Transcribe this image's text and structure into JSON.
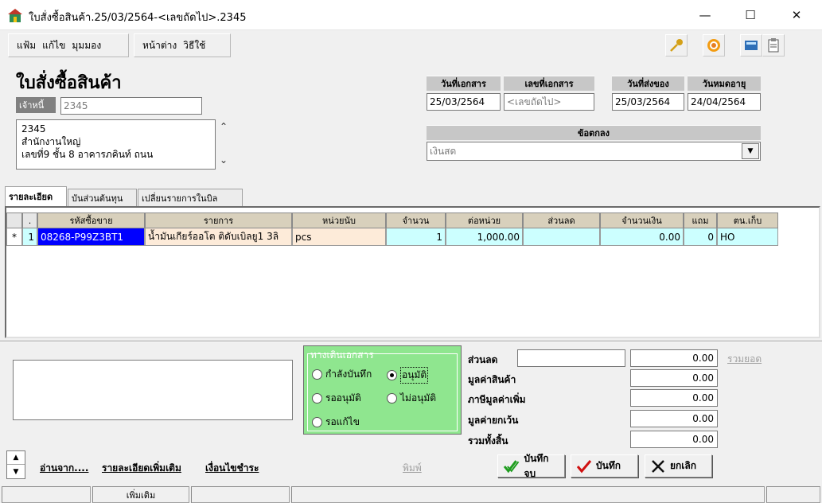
{
  "window": {
    "title": "ใบสั่งซื้อสินค้า.25/03/2564-<เลขถัดไป>.2345",
    "min": "—",
    "max": "☐",
    "close": "✕"
  },
  "menu": {
    "file": "แฟ้ม",
    "edit": "แก้ไข",
    "view": "มุมมอง",
    "window": "หน้าต่าง",
    "help": "วิธีใช้"
  },
  "header": {
    "doc_title": "ใบสั่งซื้อสินค้า",
    "creditor_label": "เจ้าหนี้",
    "creditor_value": "2345",
    "address_lines": [
      "2345",
      "สำนักงานใหญ่",
      "เลขที่9 ชั้น 8 อาคารภคินท์ ถนน"
    ],
    "doc_date_label": "วันที่เอกสาร",
    "doc_date_value": "25/03/2564",
    "doc_no_label": "เลขที่เอกสาร",
    "doc_no_value": "<เลขถัดไป>",
    "ship_date_label": "วันที่ส่งของ",
    "ship_date_value": "25/03/2564",
    "expire_label": "วันหมดอายุ",
    "expire_value": "24/04/2564",
    "terms_label": "ข้อตกลง",
    "terms_value": "เงินสด"
  },
  "tabs": [
    "รายละเอียด",
    "บันส่วนต้นทุน",
    "เปลี่ยนรายการในบิล"
  ],
  "grid": {
    "columns": [
      ".",
      "รหัสซื้อขาย",
      "รายการ",
      "หน่วยนับ",
      "จำนวน",
      "ต่อหน่วย",
      "ส่วนลด",
      "จำนวนเงิน",
      "แถม",
      "ตน.เก็บ"
    ],
    "rows": [
      {
        "marker": "*",
        "no": "1",
        "code": "08268-P99Z3BT1",
        "item": "น้ำมันเกียร์ออโต ติดับเบิลยู1 3ลิ",
        "unit": "pcs",
        "qty": "1",
        "price": "1,000.00",
        "discount": "",
        "amount": "0.00",
        "free": "0",
        "store": "HO"
      }
    ]
  },
  "status_panel": {
    "title": "ทางเดินเอกสาร",
    "options": [
      "กำลังบันทึก",
      "อนุมัติ",
      "รออนุมัติ",
      "ไม่อนุมัติ",
      "รอแก้ไข"
    ],
    "selected": "อนุมัติ"
  },
  "summary": {
    "discount_label": "ส่วนลด",
    "discount_input": "",
    "discount_value": "0.00",
    "total_link": "รวมยอด",
    "goods_label": "มูลค่าสินค้า",
    "goods_value": "0.00",
    "vat_label": "ภาษีมูลค่าเพิ่ม",
    "vat_value": "0.00",
    "exempt_label": "มูลค่ายกเว้น",
    "exempt_value": "0.00",
    "grand_label": "รวมทั้งสิ้น",
    "grand_value": "0.00"
  },
  "links": {
    "read_from": "อ่านจาก....",
    "more_detail": "รายละเอียดเพิ่มเติม",
    "payment_terms": "เงื่อนไขชำระ",
    "print": "พิมพ์"
  },
  "buttons": {
    "save_close": "บันทึกจบ",
    "save": "บันทึก",
    "cancel": "ยกเลิก"
  },
  "statusbar": {
    "more": "เพิ่มเติม"
  },
  "colors": {
    "selected_cell": "#0000ff",
    "peach_cell": "#fdebd9",
    "cyan_cell": "#ccffff",
    "status_green": "#8fe68f"
  }
}
